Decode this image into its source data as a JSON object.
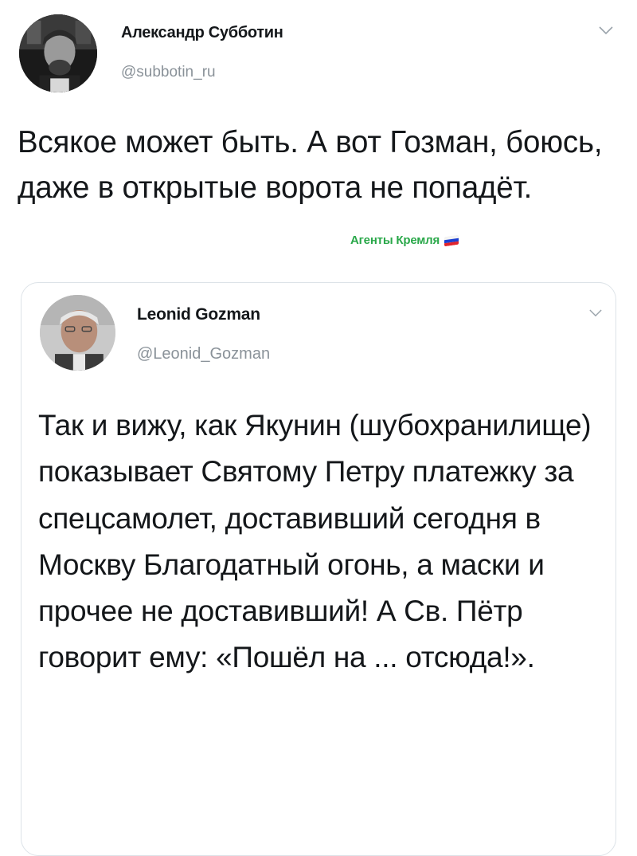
{
  "tweet": {
    "author_name": "Александр Субботин",
    "author_handle": "@subbotin_ru",
    "text": "Всякое может быть. А вот Гозман, боюсь, даже в открытые ворота не попадёт.",
    "menu_icon": "chevron-down-icon",
    "avatar_icon": "user-avatar"
  },
  "watermark": {
    "label": "Агенты Кремля",
    "flag_colors": [
      "#ffffff",
      "#1c3fd1",
      "#e0242c"
    ],
    "color": "#2aa84a"
  },
  "quoted_tweet": {
    "author_name": "Leonid Gozman",
    "author_handle": "@Leonid_Gozman",
    "text": "Так и вижу, как Якунин (шубохранилище) показывает Святому Петру платежку за спецсамолет, доставивший сегодня в Москву Благодатный огонь, а маски и прочее не доставивший! А Св. Пётр говорит ему: «Пошёл на ... отсюда!».",
    "menu_icon": "chevron-down-icon",
    "avatar_icon": "user-avatar"
  },
  "colors": {
    "text": "#14171a",
    "secondary": "#8a9299",
    "border": "#dde3e8"
  }
}
